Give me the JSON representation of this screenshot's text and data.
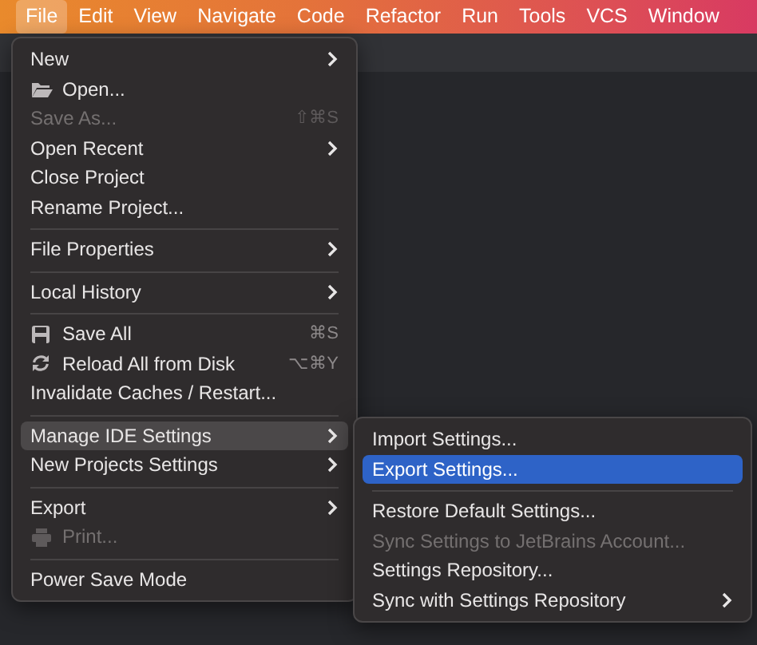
{
  "menubar": [
    {
      "label": "File",
      "selected": true
    },
    {
      "label": "Edit",
      "selected": false
    },
    {
      "label": "View",
      "selected": false
    },
    {
      "label": "Navigate",
      "selected": false
    },
    {
      "label": "Code",
      "selected": false
    },
    {
      "label": "Refactor",
      "selected": false
    },
    {
      "label": "Run",
      "selected": false
    },
    {
      "label": "Tools",
      "selected": false
    },
    {
      "label": "VCS",
      "selected": false
    },
    {
      "label": "Window",
      "selected": false
    }
  ],
  "file_menu": [
    {
      "kind": "item",
      "label": "New",
      "submenu": true,
      "disabled": false,
      "selected": false
    },
    {
      "kind": "folder",
      "label": "Open...",
      "disabled": false,
      "selected": false
    },
    {
      "kind": "item",
      "label": "Save As...",
      "shortcut": "⇧⌘S",
      "disabled": true,
      "selected": false
    },
    {
      "kind": "item",
      "label": "Open Recent",
      "submenu": true,
      "disabled": false,
      "selected": false
    },
    {
      "kind": "item",
      "label": "Close Project",
      "disabled": false,
      "selected": false
    },
    {
      "kind": "item",
      "label": "Rename Project...",
      "disabled": false,
      "selected": false
    },
    {
      "kind": "separator"
    },
    {
      "kind": "item",
      "label": "File Properties",
      "submenu": true,
      "disabled": false,
      "selected": false
    },
    {
      "kind": "separator"
    },
    {
      "kind": "item",
      "label": "Local History",
      "submenu": true,
      "disabled": false,
      "selected": false
    },
    {
      "kind": "separator"
    },
    {
      "kind": "floppy",
      "label": "Save All",
      "shortcut": "⌘S",
      "disabled": false,
      "selected": false
    },
    {
      "kind": "reload",
      "label": "Reload All from Disk",
      "shortcut": "⌥⌘Y",
      "disabled": false,
      "selected": false
    },
    {
      "kind": "item",
      "label": "Invalidate Caches / Restart...",
      "disabled": false,
      "selected": false
    },
    {
      "kind": "separator"
    },
    {
      "kind": "item",
      "label": "Manage IDE Settings",
      "submenu": true,
      "disabled": false,
      "selected": true
    },
    {
      "kind": "item",
      "label": "New Projects Settings",
      "submenu": true,
      "disabled": false,
      "selected": false
    },
    {
      "kind": "separator"
    },
    {
      "kind": "item",
      "label": "Export",
      "submenu": true,
      "disabled": false,
      "selected": false
    },
    {
      "kind": "printer",
      "label": "Print...",
      "disabled": true,
      "selected": false
    },
    {
      "kind": "separator"
    },
    {
      "kind": "item",
      "label": "Power Save Mode",
      "disabled": false,
      "selected": false
    }
  ],
  "settings_submenu": [
    {
      "kind": "item",
      "label": "Import Settings...",
      "disabled": false,
      "selected": false
    },
    {
      "kind": "item",
      "label": "Export Settings...",
      "disabled": false,
      "selected": true
    },
    {
      "kind": "separator"
    },
    {
      "kind": "item",
      "label": "Restore Default Settings...",
      "disabled": false,
      "selected": false
    },
    {
      "kind": "item",
      "label": "Sync Settings to JetBrains Account...",
      "disabled": true,
      "selected": false
    },
    {
      "kind": "item",
      "label": "Settings Repository...",
      "disabled": false,
      "selected": false
    },
    {
      "kind": "item",
      "label": "Sync with Settings Repository",
      "submenu": true,
      "disabled": false,
      "selected": false
    }
  ]
}
